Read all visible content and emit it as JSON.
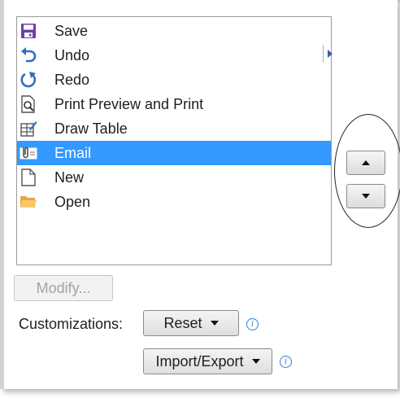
{
  "command_list": {
    "items": [
      {
        "label": "Save",
        "icon": "save-icon"
      },
      {
        "label": "Undo",
        "icon": "undo-icon"
      },
      {
        "label": "Redo",
        "icon": "redo-icon"
      },
      {
        "label": "Print Preview and Print",
        "icon": "print-preview-icon"
      },
      {
        "label": "Draw Table",
        "icon": "draw-table-icon"
      },
      {
        "label": "Email",
        "icon": "email-icon",
        "selected": true
      },
      {
        "label": "New",
        "icon": "new-document-icon"
      },
      {
        "label": "Open",
        "icon": "open-folder-icon"
      }
    ]
  },
  "move_buttons": {
    "up_icon": "move-up-icon",
    "down_icon": "move-down-icon"
  },
  "modify_button": {
    "label": "Modify..."
  },
  "customizations": {
    "label": "Customizations:",
    "reset_label": "Reset",
    "import_export_label": "Import/Export",
    "info_glyph": "i"
  },
  "colors": {
    "selection": "#3399ff",
    "accent_blue": "#3a7bd5",
    "save_purple": "#6d3fa4",
    "undo_blue": "#2f6dc2"
  }
}
